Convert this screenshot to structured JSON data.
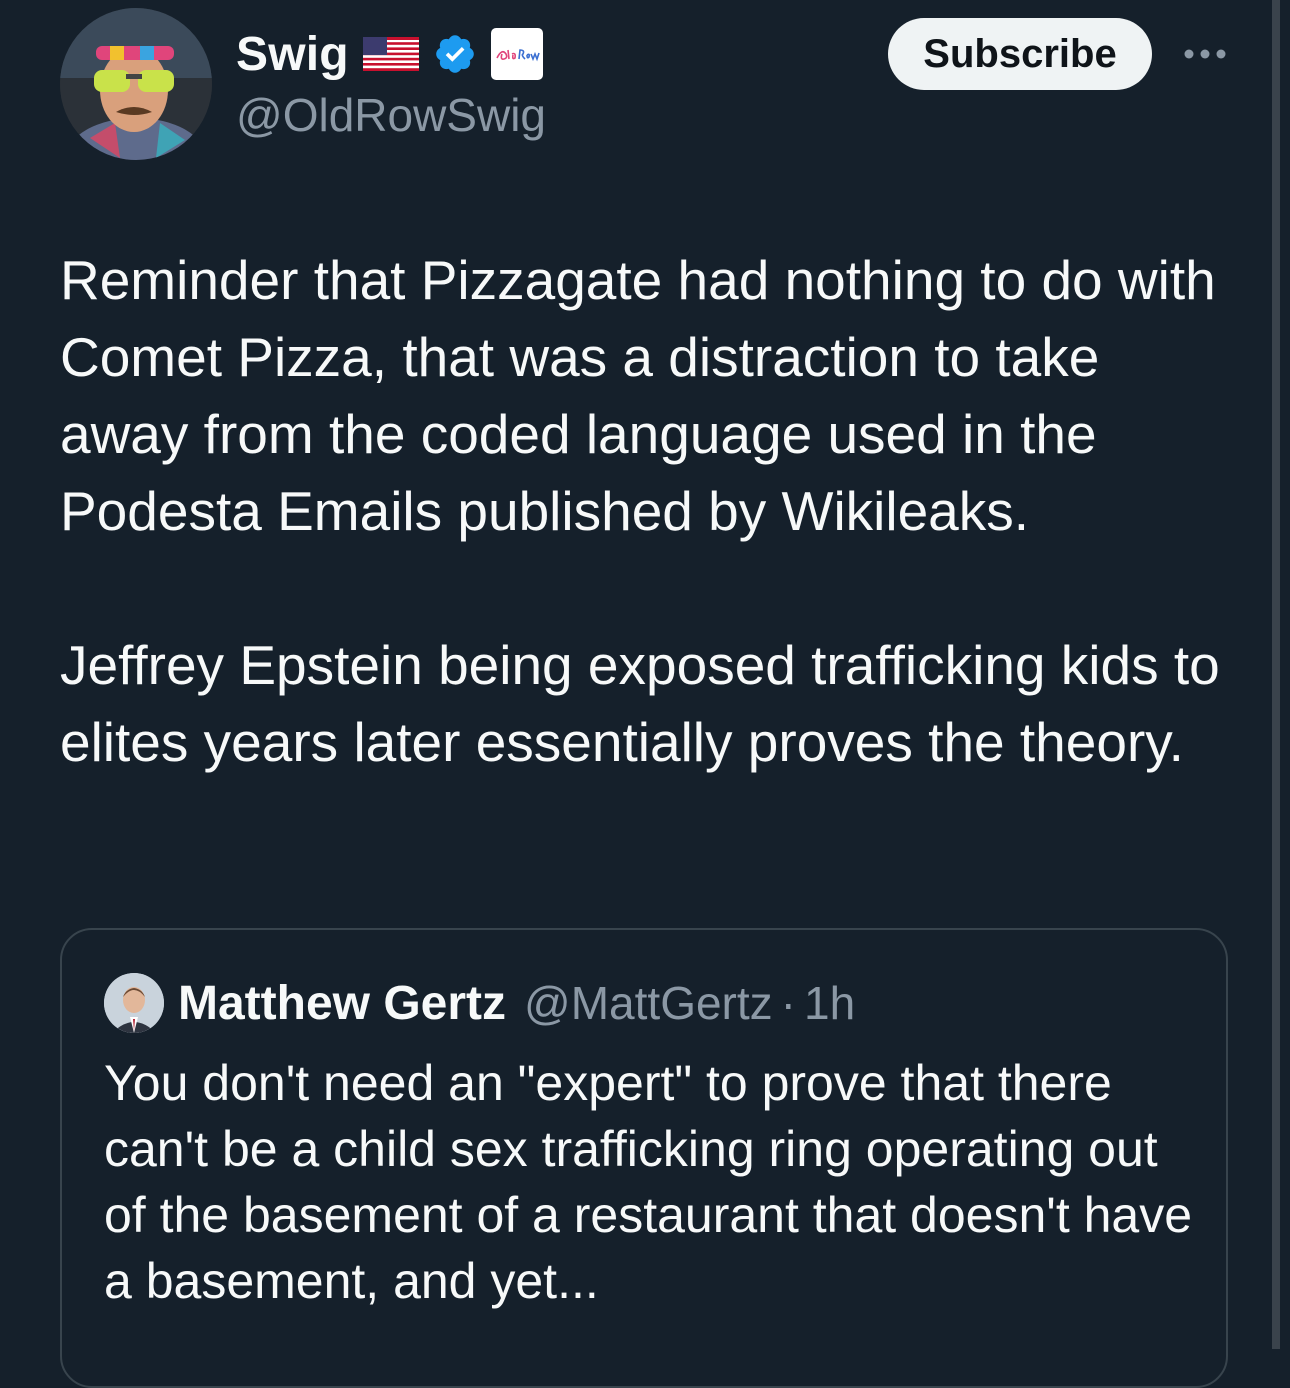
{
  "author": {
    "display_name": "Swig",
    "handle": "@OldRowSwig",
    "affiliate_badge_text": "Old Row"
  },
  "actions": {
    "subscribe_label": "Subscribe",
    "more_icon": "more-horizontal-icon"
  },
  "tweet": {
    "text": "Reminder that Pizzagate had nothing to do with Comet Pizza, that was a distraction to take away from the coded language used in the Podesta Emails published by Wikileaks.\n\nJeffrey Epstein being exposed trafficking kids to elites years later essentially proves the theory."
  },
  "quote": {
    "display_name": "Matthew Gertz",
    "handle": "@MattGertz",
    "separator": "·",
    "time": "1h",
    "text": "You don't need an \"expert\" to prove that there can't be a child sex trafficking ring operating out of the basement of a restaurant that doesn't have a basement, and yet..."
  },
  "colors": {
    "background": "#15202b",
    "text_primary": "#f7f9f9",
    "text_secondary": "#8b98a5",
    "verified_blue": "#1d9bf0",
    "card_border": "#38444d",
    "subscribe_bg": "#eff3f4"
  }
}
